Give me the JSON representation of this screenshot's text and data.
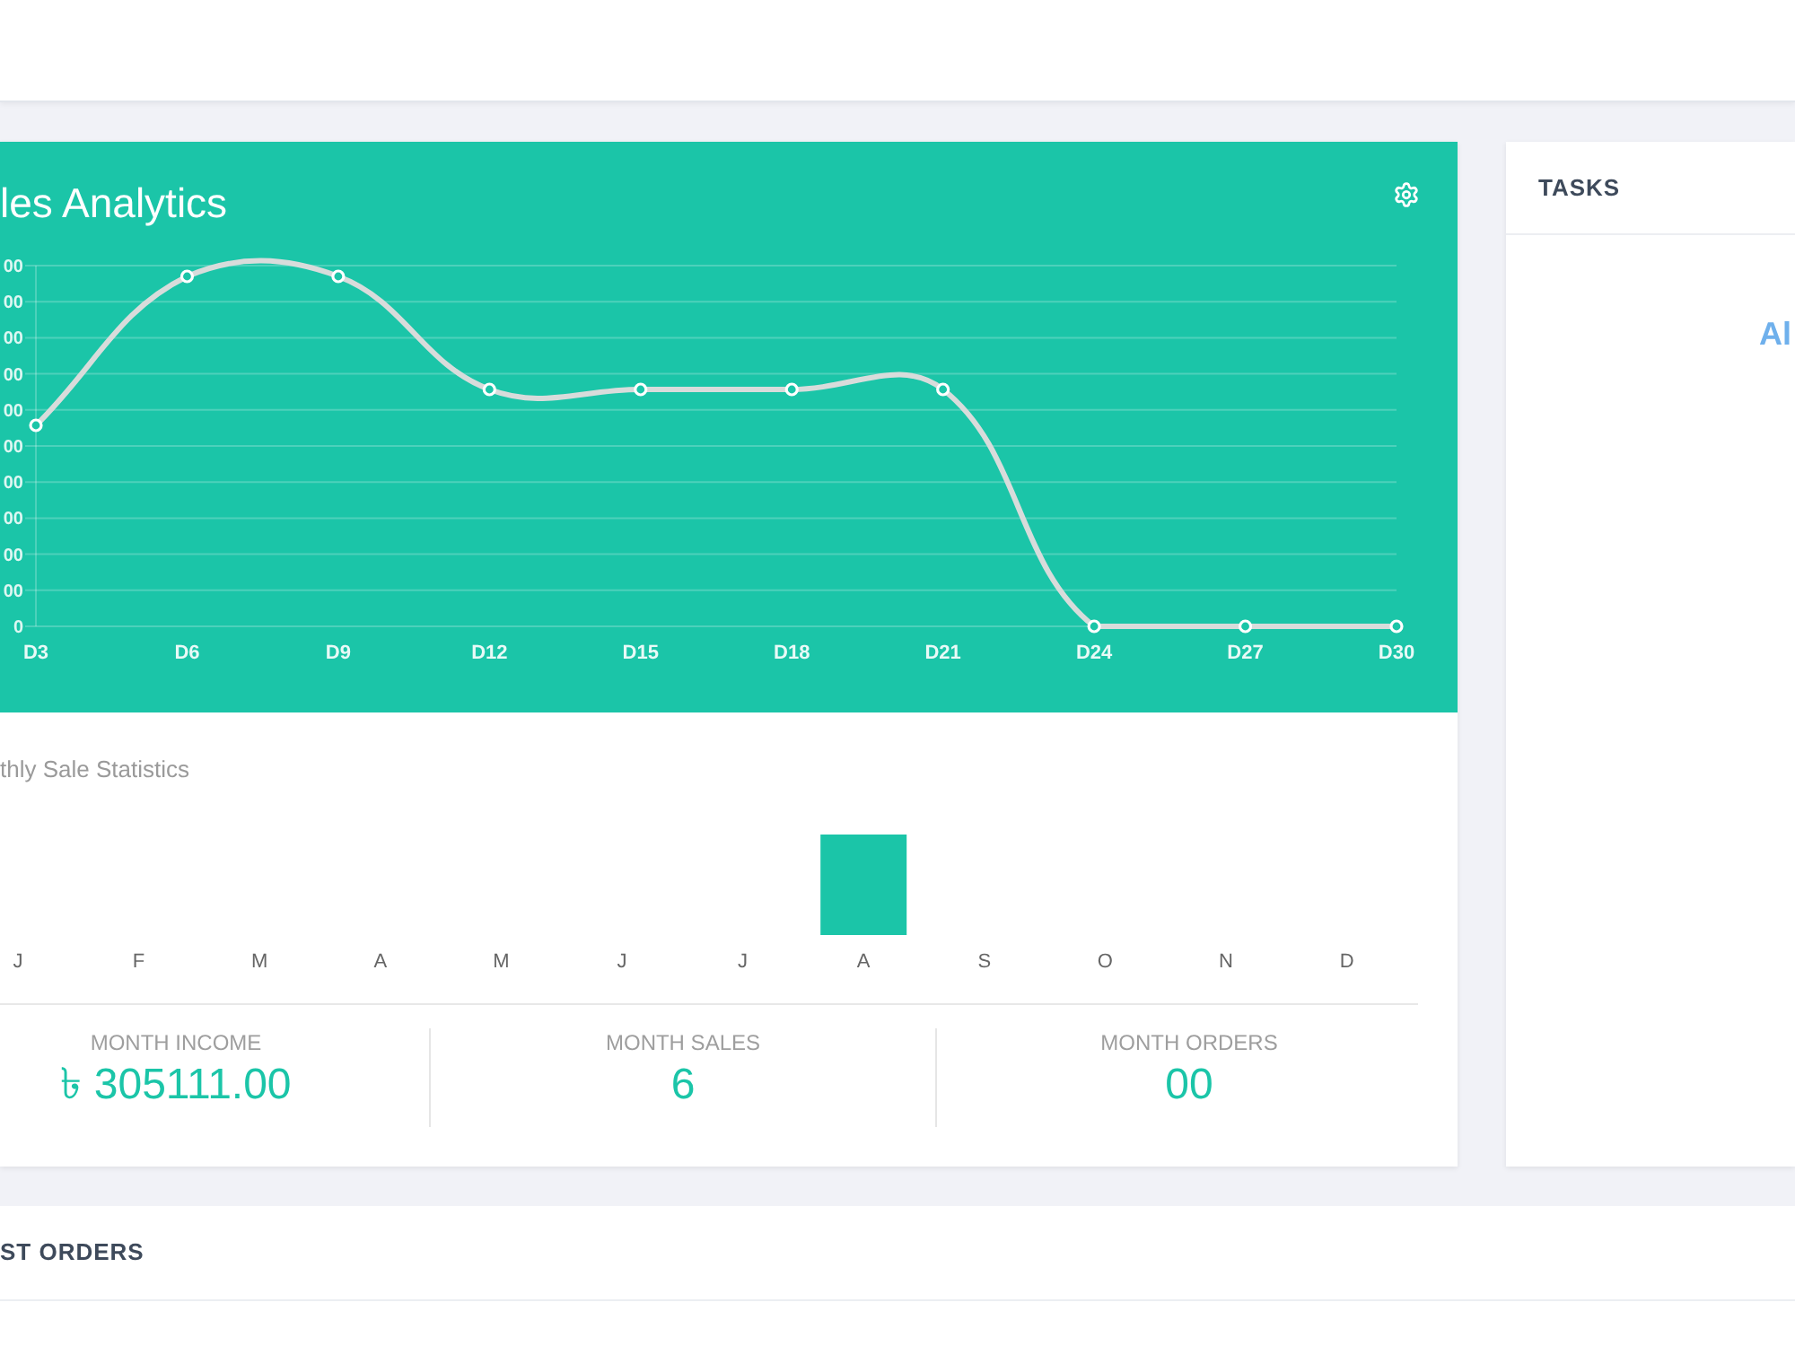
{
  "sales_analytics": {
    "title": "les Analytics",
    "y_tick_labels": [
      "00",
      "00",
      "00",
      "00",
      "00",
      "00",
      "00",
      "00",
      "00",
      "00",
      "0"
    ],
    "x_labels": [
      "D3",
      "D6",
      "D9",
      "D12",
      "D15",
      "D18",
      "D21",
      "D24",
      "D27",
      "D30"
    ]
  },
  "monthly_sales": {
    "title": "thly Sale Statistics",
    "months": [
      "J",
      "F",
      "M",
      "A",
      "M",
      "J",
      "J",
      "A",
      "S",
      "O",
      "N",
      "D"
    ],
    "summary": [
      {
        "label": "MONTH INCOME",
        "value": "৳ 305111.00"
      },
      {
        "label": "MONTH SALES",
        "value": "6"
      },
      {
        "label": "MONTH ORDERS",
        "value": "00"
      }
    ]
  },
  "tasks": {
    "title": "TASKS",
    "message": "Al"
  },
  "latest_orders": {
    "title": "ST ORDERS"
  }
}
